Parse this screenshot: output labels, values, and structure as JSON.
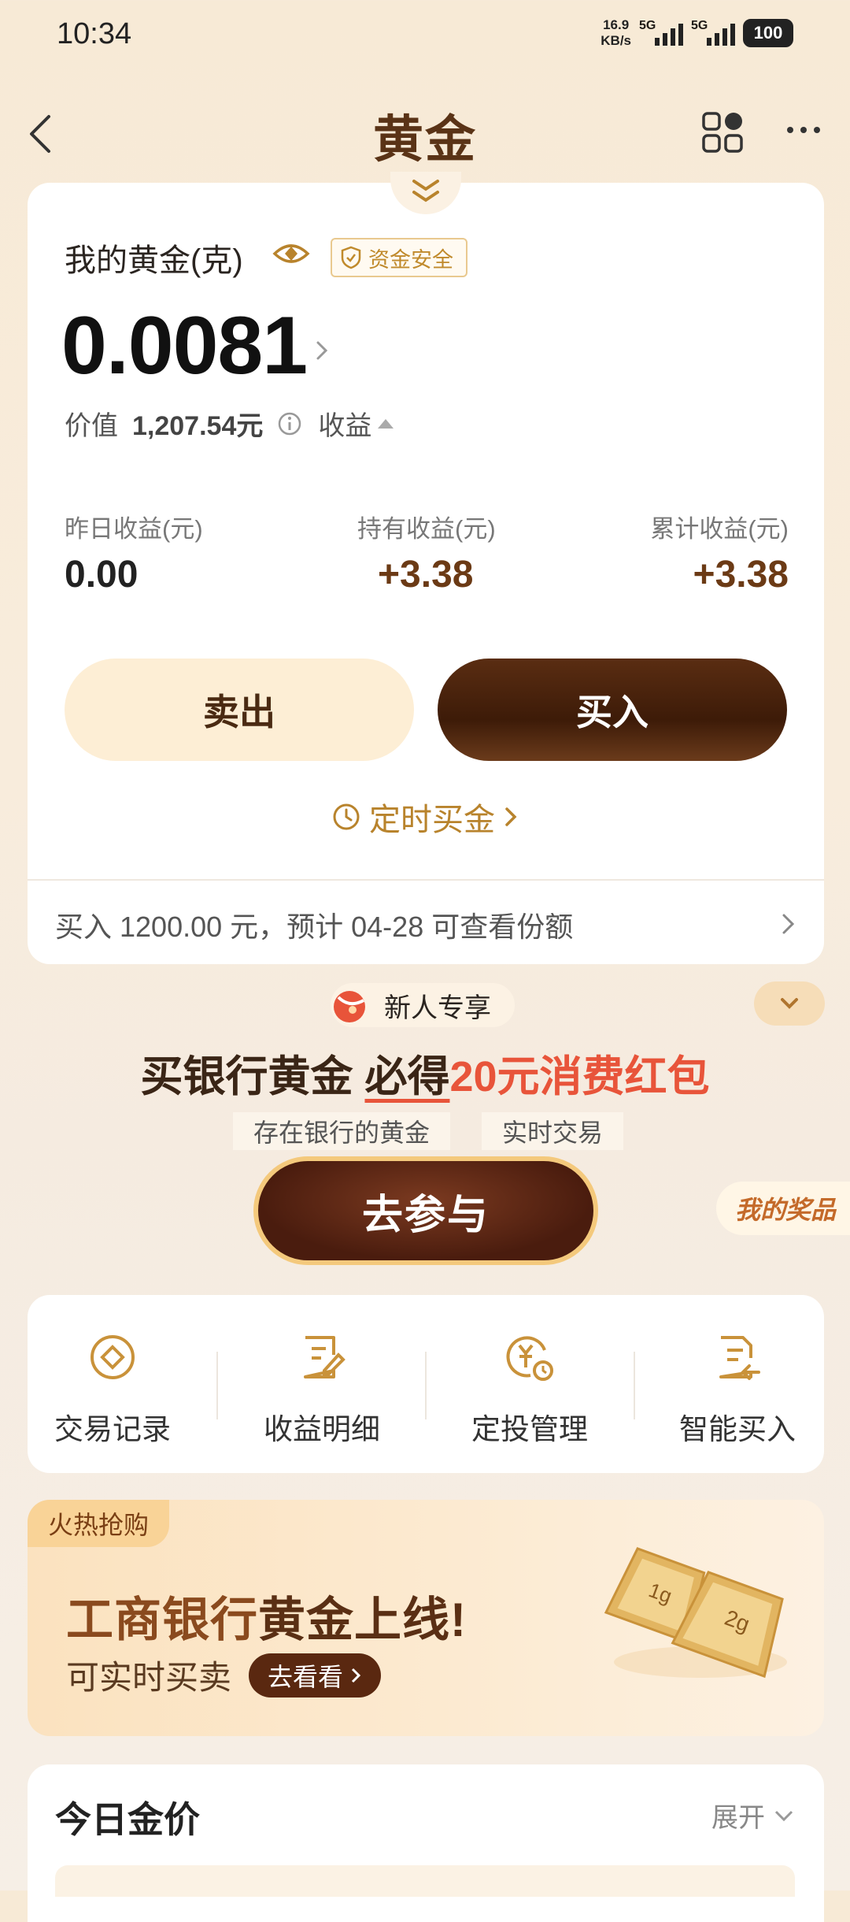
{
  "status_bar": {
    "time": "10:34",
    "net_speed_value": "16.9",
    "net_speed_unit": "KB/s",
    "sim1": "5G",
    "sim2": "5G",
    "battery": "100"
  },
  "nav": {
    "title": "黄金"
  },
  "holdings": {
    "label": "我的黄金(克)",
    "safe_badge": "资金安全",
    "amount": "0.0081",
    "value_label": "价值",
    "value": "1,207.54元",
    "earnings_toggle": "收益",
    "stats": [
      {
        "label": "昨日收益(元)",
        "value": "0.00"
      },
      {
        "label": "持有收益(元)",
        "value": "+3.38"
      },
      {
        "label": "累计收益(元)",
        "value": "+3.38"
      }
    ],
    "sell": "卖出",
    "buy": "买入",
    "timed_buy": "定时买金",
    "pending": "买入 1200.00 元，预计 04-28 可查看份额"
  },
  "promo": {
    "newbie": "新人专享",
    "headline_a": "买银行黄金 ",
    "headline_b": "必得",
    "headline_c": "20元消费红包",
    "tags": [
      "存在银行的黄金",
      "实时交易"
    ],
    "join": "去参与",
    "my_prize": "我的奖品"
  },
  "quick_actions": [
    {
      "label": "交易记录",
      "icon": "record-icon"
    },
    {
      "label": "收益明细",
      "icon": "edit-document-icon"
    },
    {
      "label": "定投管理",
      "icon": "yuan-clock-icon"
    },
    {
      "label": "智能买入",
      "icon": "document-return-icon"
    }
  ],
  "banner": {
    "tag": "火热抢购",
    "title_a": "工商银行",
    "title_b": "黄金上线!",
    "sub": "可实时买卖",
    "cta": "去看看",
    "bar1": "1g",
    "bar2": "2g"
  },
  "today_price": {
    "title": "今日金价",
    "expand": "展开"
  },
  "colors": {
    "brand_dark": "#5a3316",
    "gold": "#b8832c",
    "accent_red": "#e8543a"
  }
}
